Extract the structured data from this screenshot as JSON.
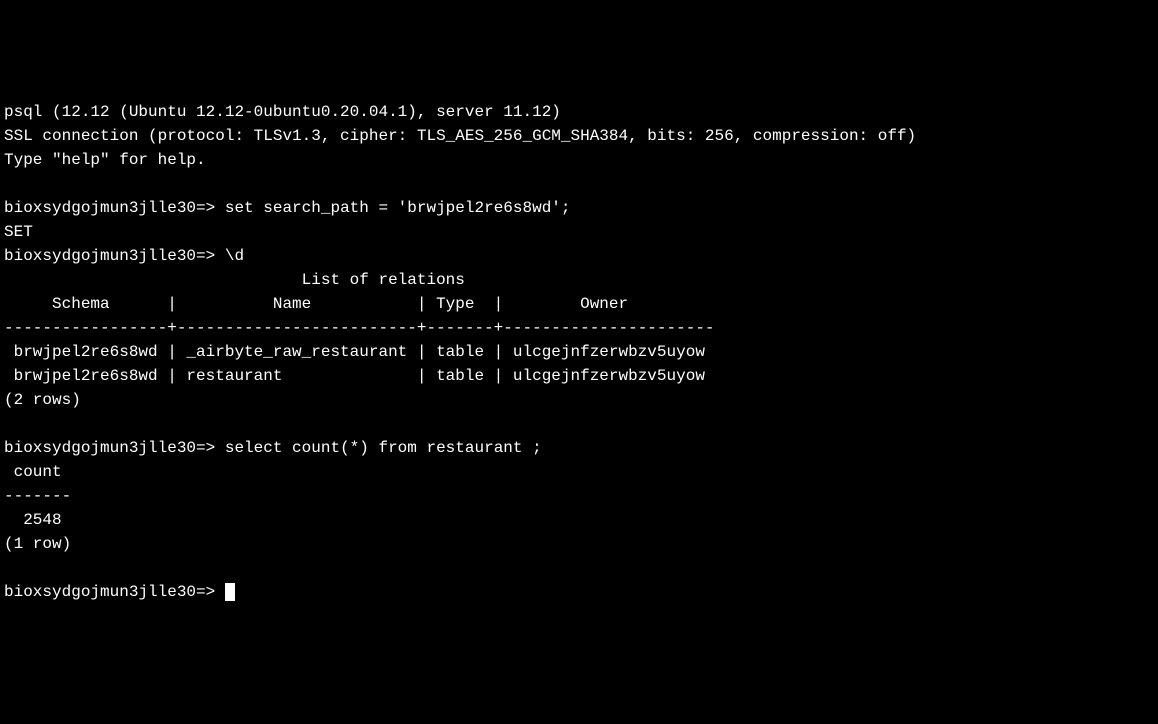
{
  "header": {
    "version_line": "psql (12.12 (Ubuntu 12.12-0ubuntu0.20.04.1), server 11.12)",
    "ssl_line": "SSL connection (protocol: TLSv1.3, cipher: TLS_AES_256_GCM_SHA384, bits: 256, compression: off)",
    "help_line": "Type \"help\" for help."
  },
  "prompt": "bioxsydgojmun3jlle30=> ",
  "commands": {
    "set_search_path": "set search_path = 'brwjpel2re6s8wd';",
    "set_result": "SET",
    "describe": "\\d",
    "select_count": "select count(*) from restaurant ;"
  },
  "relations": {
    "title": "                               List of relations",
    "header": "     Schema      |          Name           | Type  |        Owner",
    "separator": "-----------------+-------------------------+-------+----------------------",
    "row1": " brwjpel2re6s8wd | _airbyte_raw_restaurant | table | ulcgejnfzerwbzv5uyow",
    "row2": " brwjpel2re6s8wd | restaurant              | table | ulcgejnfzerwbzv5uyow",
    "footer": "(2 rows)"
  },
  "count_result": {
    "header": " count",
    "separator": "-------",
    "value": "  2548",
    "footer": "(1 row)"
  }
}
